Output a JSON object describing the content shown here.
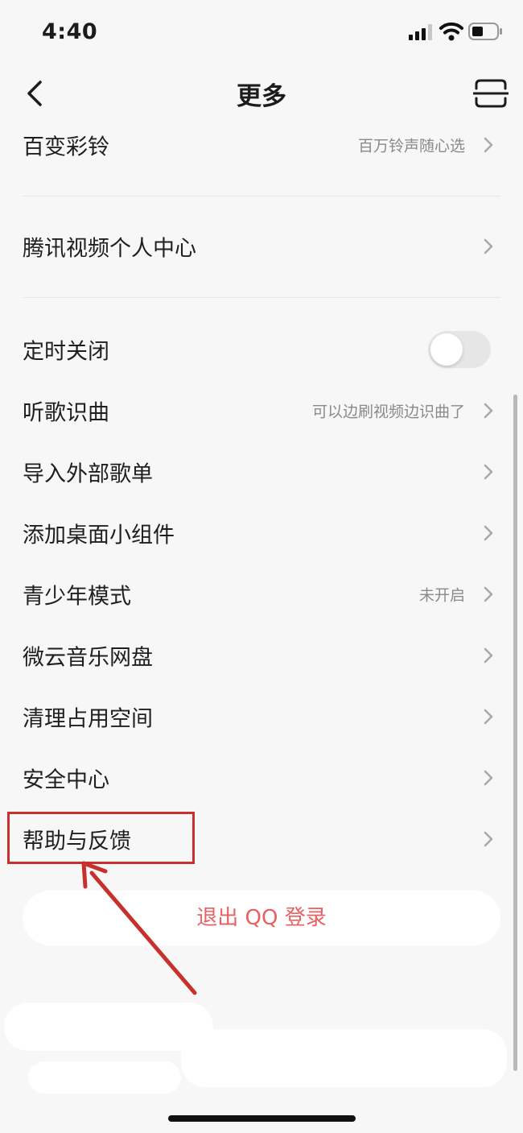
{
  "status_bar": {
    "time": "4:40"
  },
  "nav": {
    "title": "更多"
  },
  "rows": [
    {
      "label": "百变彩铃",
      "sub": "百万铃声随心选"
    },
    {
      "label": "腾讯视频个人中心",
      "sub": ""
    },
    {
      "label": "定时关闭",
      "toggle_on": false
    },
    {
      "label": "听歌识曲",
      "sub": "可以边刷视频边识曲了"
    },
    {
      "label": "导入外部歌单",
      "sub": ""
    },
    {
      "label": "添加桌面小组件",
      "sub": ""
    },
    {
      "label": "青少年模式",
      "sub": "未开启"
    },
    {
      "label": "微云音乐网盘",
      "sub": ""
    },
    {
      "label": "清理占用空间",
      "sub": ""
    },
    {
      "label": "安全中心",
      "sub": ""
    },
    {
      "label": "帮助与反馈",
      "sub": ""
    }
  ],
  "logout_label": "退出 QQ 登录",
  "colors": {
    "accent_red": "#e8605f",
    "annotation_red": "#c7312c",
    "background": "#f7f7f7"
  }
}
